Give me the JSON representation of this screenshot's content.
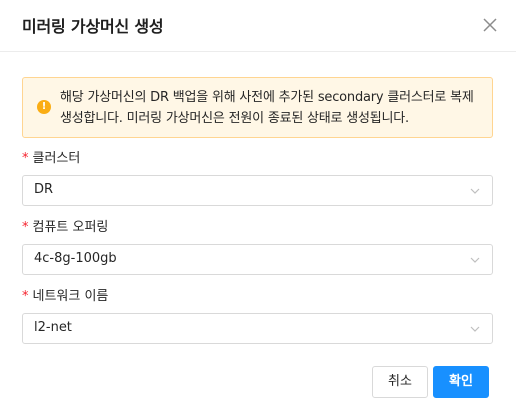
{
  "dialog": {
    "title": "미러링 가상머신 생성"
  },
  "alert": {
    "icon": "warning-icon",
    "color": "#faad14",
    "message": "해당 가상머신의 DR 백업을 위해 사전에 추가된 secondary 클러스터로 복제 생성합니다. 미러링 가상머신은 전원이 종료된 상태로 생성됩니다."
  },
  "fields": {
    "cluster": {
      "required_mark": "*",
      "label": "클러스터",
      "value": "DR"
    },
    "compute_offering": {
      "required_mark": "*",
      "label": "컴퓨트 오퍼링",
      "value": "4c-8g-100gb"
    },
    "network": {
      "required_mark": "*",
      "label": "네트워크 이름",
      "value": "l2-net"
    }
  },
  "footer": {
    "cancel_label": "취소",
    "ok_label": "확인",
    "ok_color": "#1890ff"
  }
}
